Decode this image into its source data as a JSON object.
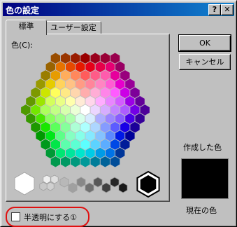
{
  "window": {
    "title": "色の設定"
  },
  "titlebar_buttons": {
    "help": "?",
    "close": "✕"
  },
  "tabs": [
    {
      "label": "標準"
    },
    {
      "label": "ユーザー設定"
    }
  ],
  "color_label": "色(C):",
  "buttons": {
    "ok": "OK",
    "cancel": "キャンセル"
  },
  "new_color_label": "作成した色",
  "current_color_label": "現在の色",
  "translucent_label": "半透明にする①",
  "current_color": "#000000"
}
